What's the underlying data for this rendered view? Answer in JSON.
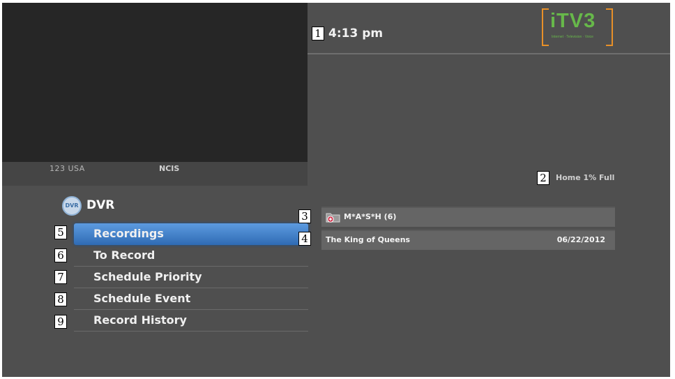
{
  "clock": "4:13 pm",
  "logo": {
    "text": "iTV3",
    "tagline": "Internet · Television · Voice"
  },
  "channel": {
    "number": "123 USA",
    "show": "NCIS"
  },
  "storage_status": "Home 1% Full",
  "dvr": {
    "icon_label": "DVR",
    "title": "DVR",
    "menu": [
      {
        "label": "Recordings",
        "selected": true
      },
      {
        "label": "To Record",
        "selected": false
      },
      {
        "label": "Schedule Priority",
        "selected": false
      },
      {
        "label": "Schedule Event",
        "selected": false
      },
      {
        "label": "Record History",
        "selected": false
      }
    ]
  },
  "recordings": [
    {
      "title": "M*A*S*H (6)",
      "icon": "folder-icon",
      "date": ""
    },
    {
      "title": "The King of Queens",
      "date": "06/22/2012"
    }
  ],
  "callouts": [
    "1",
    "2",
    "3",
    "4",
    "5",
    "6",
    "7",
    "8",
    "9"
  ],
  "colors": {
    "background": "#4f4f4f",
    "selected": "#3f7fcc",
    "logo": "#67b84a",
    "logo_bracket": "#e89028"
  }
}
